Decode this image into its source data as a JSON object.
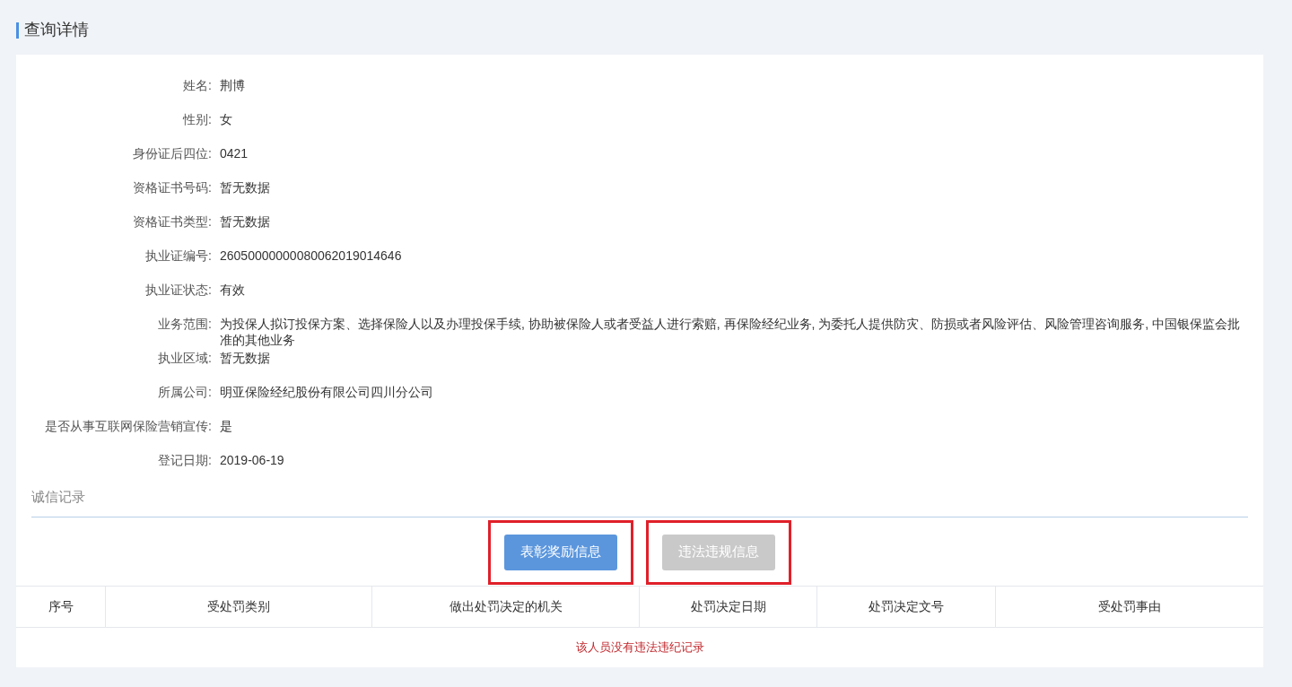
{
  "page_title": "查询详情",
  "fields": [
    {
      "label": "姓名:",
      "value": "荆博"
    },
    {
      "label": "性别:",
      "value": "女"
    },
    {
      "label": "身份证后四位:",
      "value": "0421"
    },
    {
      "label": "资格证书号码:",
      "value": "暂无数据"
    },
    {
      "label": "资格证书类型:",
      "value": "暂无数据"
    },
    {
      "label": "执业证编号:",
      "value": "26050000000080062019014646"
    },
    {
      "label": "执业证状态:",
      "value": "有效"
    },
    {
      "label": "业务范围:",
      "value": "为投保人拟订投保方案、选择保险人以及办理投保手续, 协助被保险人或者受益人进行索赔, 再保险经纪业务, 为委托人提供防灾、防损或者风险评估、风险管理咨询服务, 中国银保监会批准的其他业务"
    },
    {
      "label": "执业区域:",
      "value": "暂无数据"
    },
    {
      "label": "所属公司:",
      "value": "明亚保险经纪股份有限公司四川分公司"
    },
    {
      "label": "是否从事互联网保险营销宣传:",
      "value": "是"
    },
    {
      "label": "登记日期:",
      "value": "2019-06-19"
    }
  ],
  "section_title": "诚信记录",
  "tabs": [
    {
      "label": "表彰奖励信息",
      "selected": true,
      "highlighted": true
    },
    {
      "label": "违法违规信息",
      "selected": false,
      "highlighted": true
    }
  ],
  "table": {
    "columns": [
      "序号",
      "受处罚类别",
      "做出处罚决定的机关",
      "处罚决定日期",
      "处罚决定文号",
      "受处罚事由"
    ],
    "empty_message": "该人员没有违法违纪记录"
  }
}
